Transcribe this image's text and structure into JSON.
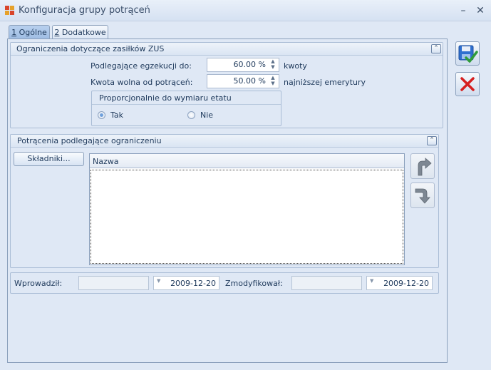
{
  "window": {
    "title": "Konfiguracja grupy potrąceń",
    "minimize_glyph": "–",
    "close_glyph": "✕"
  },
  "tabs": [
    {
      "key": "1",
      "label": " Ogólne",
      "active": true
    },
    {
      "key": "2",
      "label": " Dodatkowe",
      "active": false
    }
  ],
  "zus_group": {
    "title": "Ograniczenia dotyczące zasiłków ZUS",
    "collapse_glyph": "⌃",
    "fields": [
      {
        "label": "Podlegające egzekucji do:",
        "value": "60.00 %",
        "suffix": "kwoty"
      },
      {
        "label": "Kwota wolna od potrąceń:",
        "value": "50.00 %",
        "suffix": "najniższej emerytury"
      }
    ],
    "proportional": {
      "title": "Proporcjonalnie do wymiaru etatu",
      "options": [
        {
          "label": "Tak",
          "checked": true
        },
        {
          "label": "Nie",
          "checked": false
        }
      ]
    }
  },
  "deductions_group": {
    "title": "Potrącenia podlegające ograniczeniu",
    "collapse_glyph": "⌃",
    "components_button": "Składniki...",
    "grid": {
      "columns": [
        "Nazwa"
      ],
      "rows": []
    }
  },
  "footer": {
    "introduced_label": "Wprowadził:",
    "introduced_user": "",
    "introduced_date": "2009-12-20",
    "modified_label": "Zmodyfikował:",
    "modified_user": "",
    "modified_date": "2009-12-20"
  },
  "colors": {
    "background": "#dfe8f5",
    "text": "#1e395b",
    "save_accent": "#2e6fcf",
    "check_accent": "#2f9b3a",
    "cancel_accent": "#d61f1f"
  },
  "icons": {
    "save": "save-floppy-check-icon",
    "cancel": "red-x-icon",
    "move_up": "curved-arrow-up-icon",
    "move_down": "curved-arrow-down-icon",
    "spin": "spin-up-down-icon",
    "dropdown": "dropdown-arrow-icon"
  }
}
